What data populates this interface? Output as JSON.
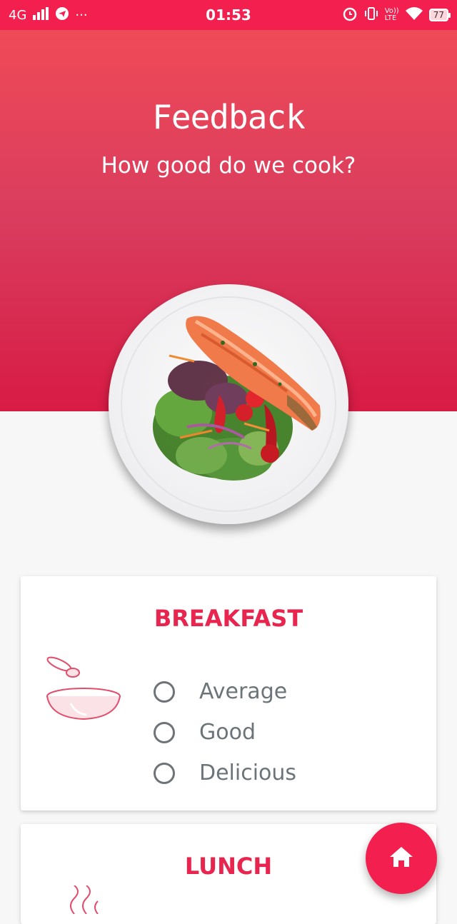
{
  "status_bar": {
    "network": "4G",
    "time": "01:53",
    "battery": "77",
    "lte_top": "Vo))",
    "lte_bottom": "LTE"
  },
  "header": {
    "title": "Feedback",
    "subtitle": "How good do we cook?"
  },
  "cards": [
    {
      "title": "BREAKFAST",
      "icon": "bowl-spoon-icon",
      "options": [
        "Average",
        "Good",
        "Delicious"
      ],
      "selected": null
    },
    {
      "title": "LUNCH",
      "icon": "steam-icon"
    }
  ],
  "fab": {
    "icon": "home-icon"
  },
  "colors": {
    "accent": "#f21f4f",
    "card_title": "#e8254f",
    "option_text": "#6b7478"
  }
}
